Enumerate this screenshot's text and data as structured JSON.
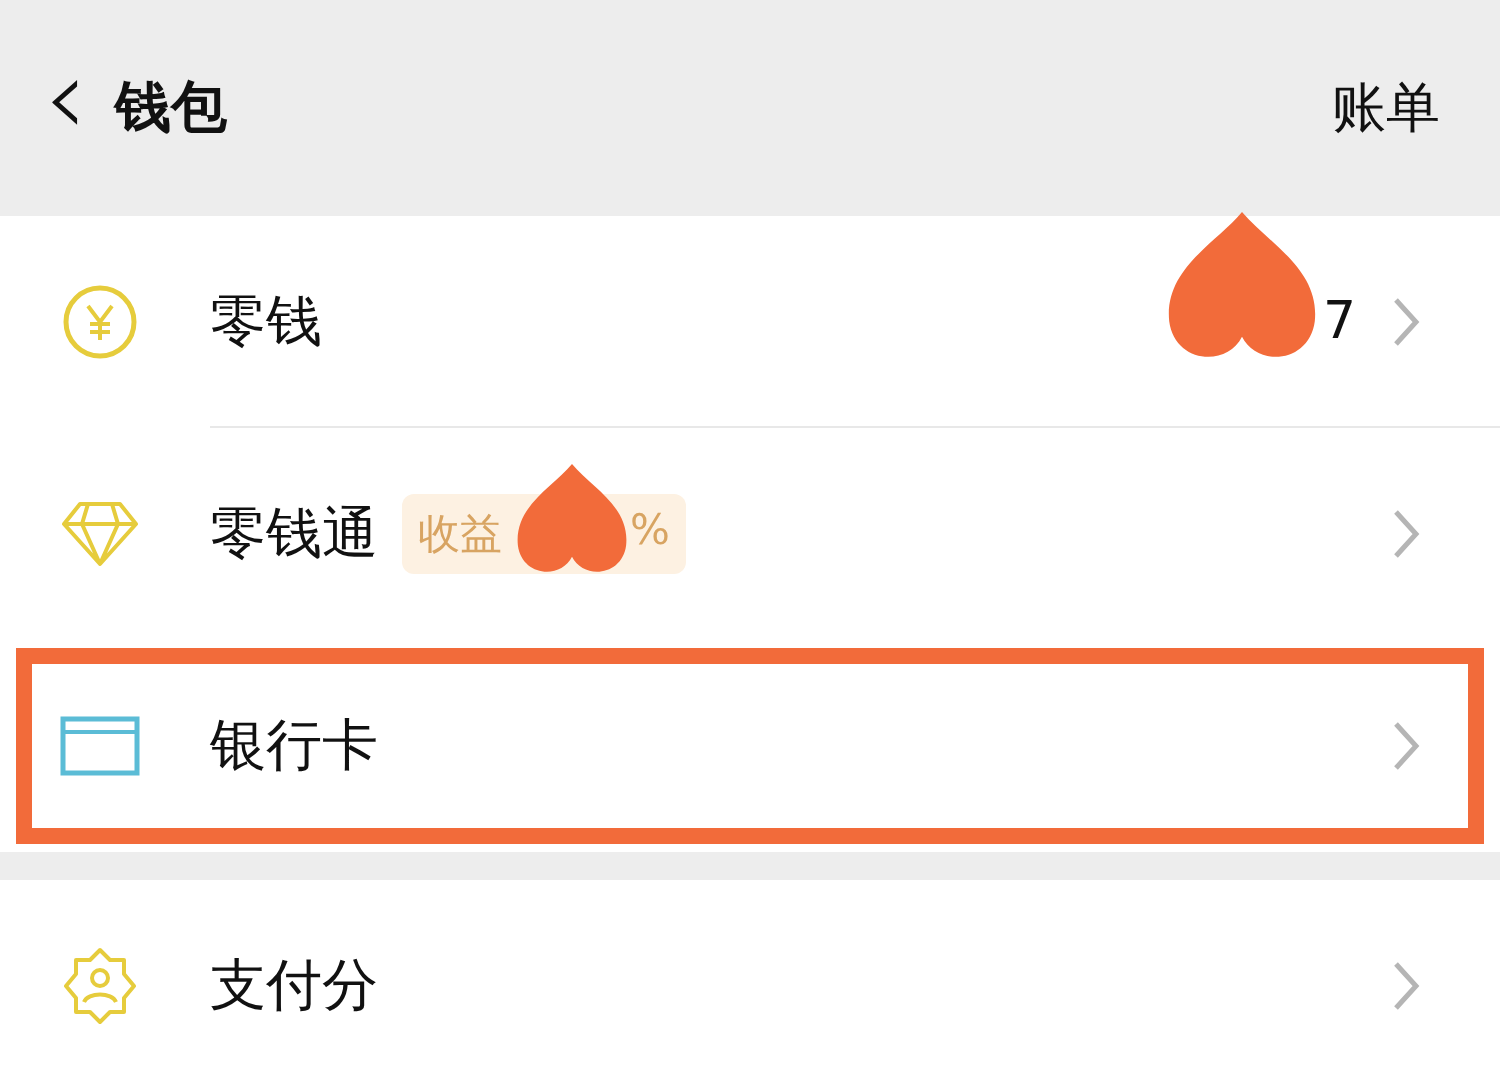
{
  "header": {
    "back_icon": "‹",
    "title": "钱包",
    "action": "账单"
  },
  "groups": [
    {
      "items": [
        {
          "kind": "coin",
          "label": "零钱",
          "value": "7",
          "value_redacted": true,
          "highlighted": false
        },
        {
          "kind": "diamond",
          "label": "零钱通",
          "badge": {
            "start": "收益",
            "end": "%",
            "redacted": true
          },
          "highlighted": false
        },
        {
          "kind": "card",
          "label": "银行卡",
          "highlighted": true
        }
      ]
    },
    {
      "items": [
        {
          "kind": "badge",
          "label": "支付分",
          "highlighted": false
        }
      ]
    }
  ]
}
